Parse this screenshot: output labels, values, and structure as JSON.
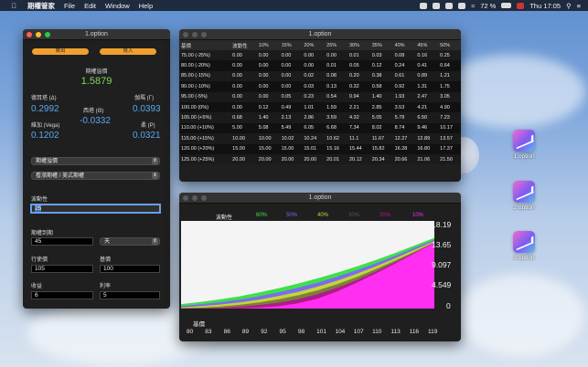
{
  "menubar": {
    "app_name": "期權管家",
    "items": [
      "File",
      "Edit",
      "Window",
      "Help"
    ],
    "battery": "72 %",
    "clock": "Thu 17:05"
  },
  "calc": {
    "title": "1.option",
    "btn_left": "賣出",
    "btn_right": "買入",
    "premium_label": "期權溢價",
    "premium_value": "1.5879",
    "delta_label": "德耳塔 (Δ)",
    "delta_value": "0.2992",
    "gamma_label": "伽瑪 (Γ)",
    "gamma_value": "0.0393",
    "theta_label": "西塔 (Θ)",
    "theta_value": "-0.0332",
    "vega_label": "維加 (Vega)",
    "vega_value": "0.1202",
    "rho_label": "柔 (P)",
    "rho_value": "0.0321",
    "select1": "期權溢價",
    "select2": "看漲期權 / 美式期權",
    "vol_label": "波動性",
    "vol_value": "25",
    "expiry_label": "期權到期",
    "expiry_value": "45",
    "expiry_unit": "天",
    "price_label": "行使價",
    "price_value": "105",
    "spot_label": "基價",
    "spot_value": "100",
    "yield_label": "收益",
    "yield_value": "6",
    "rate_label": "利率",
    "rate_value": "5"
  },
  "table_window": {
    "title": "1.option",
    "headers": [
      "基價",
      "波動性",
      "10%",
      "15%",
      "20%",
      "25%",
      "30%",
      "35%",
      "40%",
      "45%",
      "50%"
    ],
    "rows": [
      [
        "75.00 (-25%)",
        "0.00",
        "0.00",
        "0.00",
        "0.00",
        "0.00",
        "0.01",
        "0.03",
        "0.08",
        "0.16"
      ],
      [
        "80.00 (-20%)",
        "0.00",
        "0.00",
        "0.00",
        "0.00",
        "0.01",
        "0.05",
        "0.12",
        "0.24",
        "0.41"
      ],
      [
        "85.00 (-15%)",
        "0.00",
        "0.00",
        "0.00",
        "0.02",
        "0.08",
        "0.20",
        "0.38",
        "0.61",
        "0.89"
      ],
      [
        "90.00 (-10%)",
        "0.00",
        "0.00",
        "0.00",
        "0.03",
        "0.13",
        "0.32",
        "0.58",
        "0.92",
        "1.31"
      ],
      [
        "95.00 (-5%)",
        "0.00",
        "0.00",
        "0.05",
        "0.23",
        "0.54",
        "0.94",
        "1.40",
        "1.93",
        "2.47"
      ],
      [
        "100.00 (0%)",
        "0.00",
        "0.12",
        "0.49",
        "1.01",
        "1.59",
        "2.21",
        "2.85",
        "3.53",
        "4.21"
      ],
      [
        "105.00 (+5%)",
        "0.68",
        "1.40",
        "2.13",
        "2.86",
        "3.59",
        "4.32",
        "5.05",
        "5.78",
        "6.50"
      ],
      [
        "110.00 (+10%)",
        "5.00",
        "5.08",
        "5.49",
        "6.05",
        "6.68",
        "7.34",
        "8.02",
        "8.74",
        "9.46"
      ],
      [
        "115.00 (+15%)",
        "10.00",
        "10.00",
        "10.02",
        "10.24",
        "10.62",
        "11.1",
        "11.67",
        "12.27",
        "12.89"
      ],
      [
        "120.00 (+20%)",
        "15.00",
        "15.00",
        "15.00",
        "15.01",
        "15.16",
        "15.44",
        "15.82",
        "16.28",
        "16.80"
      ],
      [
        "125.00 (+25%)",
        "20.00",
        "20.00",
        "20.00",
        "20.00",
        "20.01",
        "20.12",
        "20.34",
        "20.66",
        "21.06"
      ]
    ],
    "last_col": [
      "0.25",
      "0.64",
      "1.21",
      "1.75",
      "3.05",
      "4.90",
      "7.23",
      "10.17",
      "13.57",
      "17.37",
      "21.50"
    ]
  },
  "chart_window": {
    "title": "1.option",
    "legend_title": "波動性",
    "colors": {
      "60%": "#3ee04a",
      "50%": "#7a6cf0",
      "40%": "#c8d23a",
      "30%": "#3a3a3a",
      "20%": "#b01a8a",
      "10%": "#ff2ef0"
    }
  },
  "chart_data": {
    "type": "area",
    "title": "",
    "xlabel": "基價",
    "ylabel": "",
    "x": [
      80,
      83,
      86,
      89,
      92,
      95,
      98,
      101,
      104,
      107,
      110,
      113,
      116,
      119
    ],
    "y_ticks": [
      "18.19",
      "13.65",
      "9.097",
      "4.549",
      "0"
    ],
    "ylim": [
      0,
      18.19
    ],
    "legend": [
      "60%",
      "50%",
      "40%",
      "30%",
      "20%",
      "10%"
    ],
    "series": [
      {
        "name": "60%",
        "values": [
          0.95,
          1.4,
          1.95,
          2.6,
          3.4,
          4.3,
          5.3,
          6.4,
          7.6,
          8.9,
          10.3,
          11.8,
          13.4,
          15.0
        ]
      },
      {
        "name": "50%",
        "values": [
          0.55,
          0.9,
          1.35,
          1.9,
          2.6,
          3.45,
          4.4,
          5.5,
          6.75,
          8.1,
          9.6,
          11.2,
          12.9,
          14.6
        ]
      },
      {
        "name": "40%",
        "values": [
          0.25,
          0.5,
          0.85,
          1.3,
          1.9,
          2.65,
          3.55,
          4.65,
          5.9,
          7.35,
          8.95,
          10.7,
          12.5,
          14.3
        ]
      },
      {
        "name": "30%",
        "values": [
          0.08,
          0.2,
          0.45,
          0.8,
          1.3,
          1.95,
          2.8,
          3.85,
          5.15,
          6.65,
          8.35,
          10.2,
          12.1,
          14.1
        ]
      },
      {
        "name": "20%",
        "values": [
          0.01,
          0.04,
          0.15,
          0.4,
          0.75,
          1.25,
          2.0,
          3.05,
          4.4,
          6.0,
          7.85,
          9.85,
          11.9,
          14.0
        ]
      },
      {
        "name": "10%",
        "values": [
          0,
          0,
          0.01,
          0.05,
          0.2,
          0.5,
          1.1,
          2.1,
          3.6,
          5.45,
          7.45,
          9.55,
          11.75,
          13.95
        ]
      }
    ]
  },
  "desktop_icons": [
    "1.option",
    "2.option",
    "3.option"
  ]
}
